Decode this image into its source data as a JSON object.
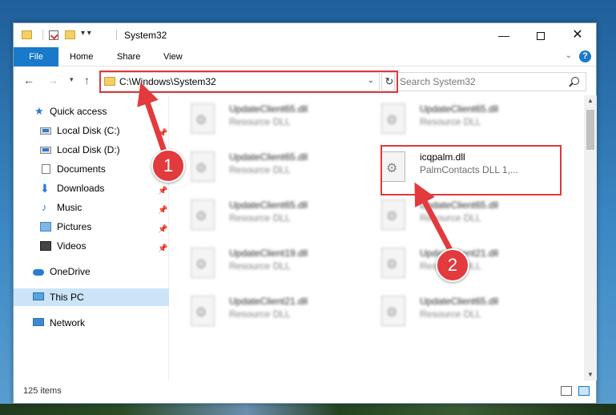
{
  "window": {
    "title": "System32",
    "controls": {
      "minimize": "—",
      "maximize": "",
      "close": "✕"
    }
  },
  "ribbon": {
    "tabs": [
      "File",
      "Home",
      "Share",
      "View"
    ]
  },
  "navigation": {
    "address": "C:\\Windows\\System32",
    "search_placeholder": "Search System32"
  },
  "sidebar": {
    "items": [
      {
        "label": "Quick access",
        "icon": "star-icon",
        "pinned": false
      },
      {
        "label": "Local Disk (C:)",
        "icon": "disk-icon",
        "pinned": true
      },
      {
        "label": "Local Disk (D:)",
        "icon": "disk-icon",
        "pinned": false
      },
      {
        "label": "Documents",
        "icon": "documents-icon",
        "pinned": true
      },
      {
        "label": "Downloads",
        "icon": "download-icon",
        "pinned": true
      },
      {
        "label": "Music",
        "icon": "music-icon",
        "pinned": true
      },
      {
        "label": "Pictures",
        "icon": "pictures-icon",
        "pinned": true
      },
      {
        "label": "Videos",
        "icon": "videos-icon",
        "pinned": true
      },
      {
        "label": "OneDrive",
        "icon": "cloud-icon",
        "pinned": false
      },
      {
        "label": "This PC",
        "icon": "computer-icon",
        "pinned": false,
        "selected": true
      },
      {
        "label": "Network",
        "icon": "network-icon",
        "pinned": false
      }
    ]
  },
  "files": [
    {
      "name": "UpdateClient65.dll",
      "type": "Resource DLL",
      "blurred": true
    },
    {
      "name": "UpdateClient65.dll",
      "type": "Resource DLL",
      "blurred": true
    },
    {
      "name": "UpdateClient65.dll",
      "type": "Resource DLL",
      "blurred": true
    },
    {
      "name": "icqpalm.dll",
      "type": "PalmContacts DLL 1,...",
      "blurred": false
    },
    {
      "name": "UpdateClient65.dll",
      "type": "Resource DLL",
      "blurred": true
    },
    {
      "name": "UpdateClient65.dll",
      "type": "Resource DLL",
      "blurred": true
    },
    {
      "name": "UpdateClient19.dll",
      "type": "Resource DLL",
      "blurred": true
    },
    {
      "name": "UpdateClient21.dll",
      "type": "Resource DLL",
      "blurred": true
    },
    {
      "name": "UpdateClient21.dll",
      "type": "Resource DLL",
      "blurred": true
    },
    {
      "name": "UpdateClient65.dll",
      "type": "Resource DLL",
      "blurred": true
    }
  ],
  "status": {
    "item_count": "125 items"
  },
  "callouts": {
    "step1": "1",
    "step2": "2"
  },
  "colors": {
    "accent": "#1979ca",
    "highlight": "#e0383a",
    "callout": "#e23a3d",
    "selection": "#cce4f7"
  }
}
